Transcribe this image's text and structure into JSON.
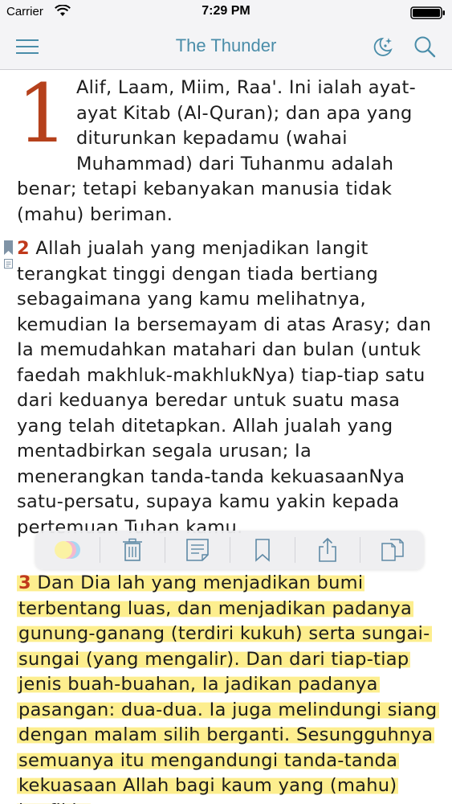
{
  "status_bar": {
    "carrier": "Carrier",
    "time": "7:29 PM"
  },
  "nav": {
    "title": "The Thunder",
    "icons": [
      "menu-icon",
      "night-mode-icon",
      "search-icon"
    ]
  },
  "colors": {
    "accent": "#4a8da9",
    "verse_number": "#c0391b",
    "highlight": "#fdee8e"
  },
  "verses": {
    "v1": {
      "dropcap": "1",
      "text": "Alif, Laam, Miim, Raa'. Ini ialah ayat-ayat Kitab (Al-Quran); dan apa yang diturunkan kepadamu (wahai Muhammad) dari Tuhanmu adalah benar; tetapi kebanyakan manusia tidak (mahu) beriman."
    },
    "v2": {
      "number": "2",
      "text": "Allah jualah yang menjadikan langit terangkat tinggi dengan tiada bertiang sebagaimana yang kamu melihatnya, kemudian Ia bersemayam di atas Arasy; dan Ia memudahkan matahari dan bulan (untuk faedah makhluk-makhlukNya) tiap-tiap satu dari keduanya beredar untuk suatu masa yang telah ditetapkan. Allah jualah yang mentadbirkan segala urusan; Ia menerangkan tanda-tanda kekuasaanNya satu-persatu, supaya kamu yakin kepada pertemuan Tuhan kamu."
    },
    "v3": {
      "number": "3",
      "text": "Dan Dia lah yang menjadikan bumi terbentang luas, dan menjadikan padanya gunung-ganang (terdiri kukuh) serta sungai-sungai (yang mengalir). Dan dari tiap-tiap jenis buah-buahan, Ia jadikan padanya pasangan: dua-dua. Ia juga melindungi siang dengan malam silih berganti. Sesungguhnya semuanya itu mengandungi tanda-tanda kekuasaan Allah bagi kaum yang (mahu) berfikir."
    }
  },
  "toolbar": {
    "icons": [
      "highlight-color-icon",
      "trash-icon",
      "note-icon",
      "bookmark-icon",
      "share-icon",
      "copy-icon"
    ]
  }
}
